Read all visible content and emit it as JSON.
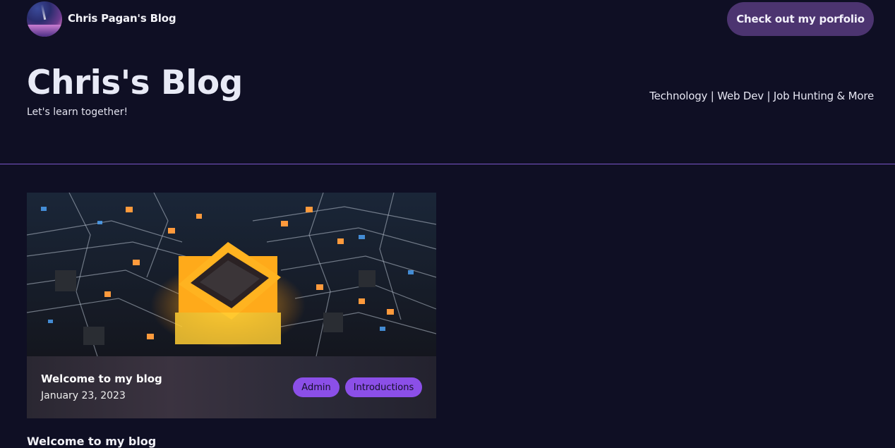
{
  "header": {
    "site_name": "Chris Pagan's Blog",
    "portfolio_button": "Check out my porfolio"
  },
  "hero": {
    "title": "Chris's Blog",
    "subtitle": "Let's learn together!",
    "topics": "Technology | Web Dev | Job Hunting & More"
  },
  "posts": [
    {
      "title": "Welcome to my blog",
      "date": "January 23, 2023",
      "tags": [
        "Admin",
        "Introductions"
      ]
    }
  ],
  "post_heading": "Welcome to my blog",
  "colors": {
    "background": "#0f0f24",
    "accent": "#8b4fe8",
    "button": "#4c3470",
    "divider": "#7a55c9"
  }
}
